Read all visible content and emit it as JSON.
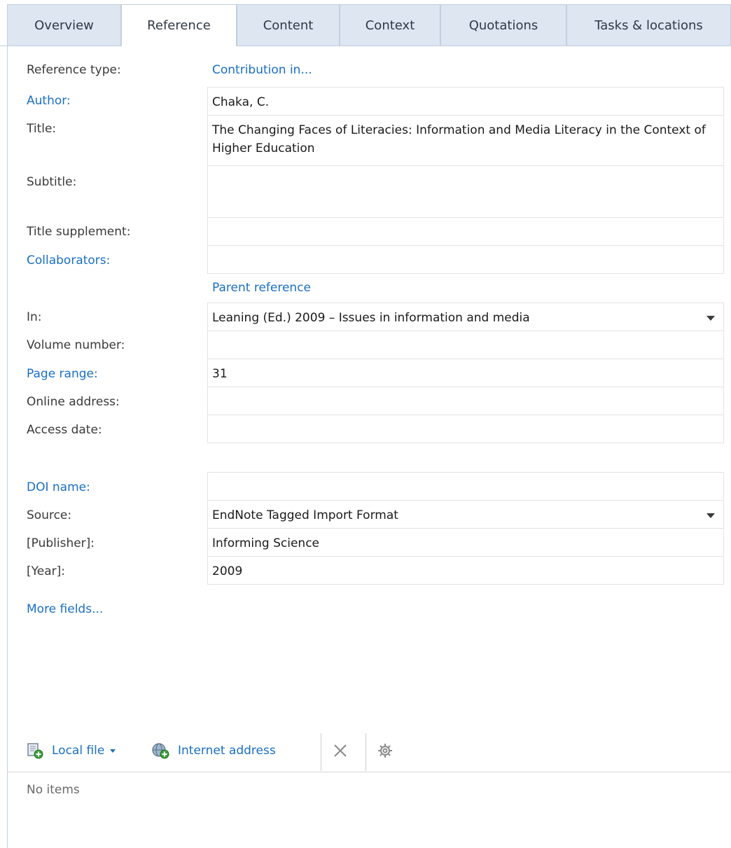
{
  "tabs": [
    {
      "label": "Overview",
      "active": false
    },
    {
      "label": "Reference",
      "active": true
    },
    {
      "label": "Content",
      "active": false
    },
    {
      "label": "Context",
      "active": false
    },
    {
      "label": "Quotations",
      "active": false
    },
    {
      "label": "Tasks & locations",
      "active": false
    }
  ],
  "reference_type": {
    "label": "Reference type:",
    "value": "Contribution in..."
  },
  "fields": {
    "author": {
      "label": "Author:",
      "value": "Chaka, C."
    },
    "title": {
      "label": "Title:",
      "value": "The Changing Faces of Literacies: Information and Media Literacy in the Context of Higher Education"
    },
    "subtitle": {
      "label": "Subtitle:",
      "value": ""
    },
    "title_supplement": {
      "label": "Title supplement:",
      "value": ""
    },
    "collaborators": {
      "label": "Collaborators:",
      "value": ""
    },
    "parent_reference_link": "Parent reference",
    "in": {
      "label": "In:",
      "value": "Leaning (Ed.) 2009 – Issues in information and media"
    },
    "volume_number": {
      "label": "Volume number:",
      "value": ""
    },
    "page_range": {
      "label": "Page range:",
      "value": "31"
    },
    "online_address": {
      "label": "Online address:",
      "value": ""
    },
    "access_date": {
      "label": "Access date:",
      "value": ""
    },
    "doi_name": {
      "label": "DOI name:",
      "value": ""
    },
    "source": {
      "label": "Source:",
      "value": "EndNote Tagged Import Format"
    },
    "publisher": {
      "label": "[Publisher]:",
      "value": "Informing Science"
    },
    "year": {
      "label": "[Year]:",
      "value": "2009"
    }
  },
  "more_fields": "More fields...",
  "toolbar": {
    "local_file": "Local file",
    "internet_address": "Internet address"
  },
  "attachments_empty": "No items",
  "colors": {
    "link": "#1a6fc4",
    "tab_inactive_bg": "#dde6f1",
    "border": "#c3cfdc"
  },
  "icons": [
    "local-file-add-icon",
    "dropdown-arrow-icon",
    "internet-address-add-icon",
    "delete-icon",
    "settings-gear-icon"
  ]
}
